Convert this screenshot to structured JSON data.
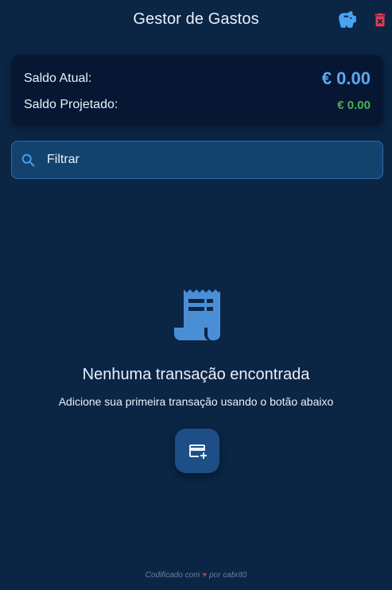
{
  "header": {
    "title": "Gestor de Gastos",
    "icons": {
      "savings": "piggy-bank-icon",
      "delete": "trash-icon"
    },
    "colors": {
      "savings": "#4aa3f0",
      "delete": "#e53950"
    }
  },
  "balance": {
    "current_label": "Saldo Atual:",
    "current_value": "€ 0.00",
    "projected_label": "Saldo Projetado:",
    "projected_value": "€ 0.00",
    "colors": {
      "current": "#5aa9f0",
      "projected": "#4caf50"
    }
  },
  "filter": {
    "placeholder": "Filtrar",
    "value": "",
    "icon": "search-icon"
  },
  "empty_state": {
    "icon": "receipt-icon",
    "title": "Nenhuma transação encontrada",
    "subtitle": "Adicione sua primeira transação usando o botão abaixo",
    "add_button_icon": "add-card-icon"
  },
  "footer": {
    "prefix": "Codificado com",
    "heart": "♥",
    "suffix": "por cabrit0"
  },
  "colors": {
    "background": "#0b2545",
    "card": "#071733",
    "filter_bg": "#13426f",
    "button_bg": "#1d4f86"
  }
}
